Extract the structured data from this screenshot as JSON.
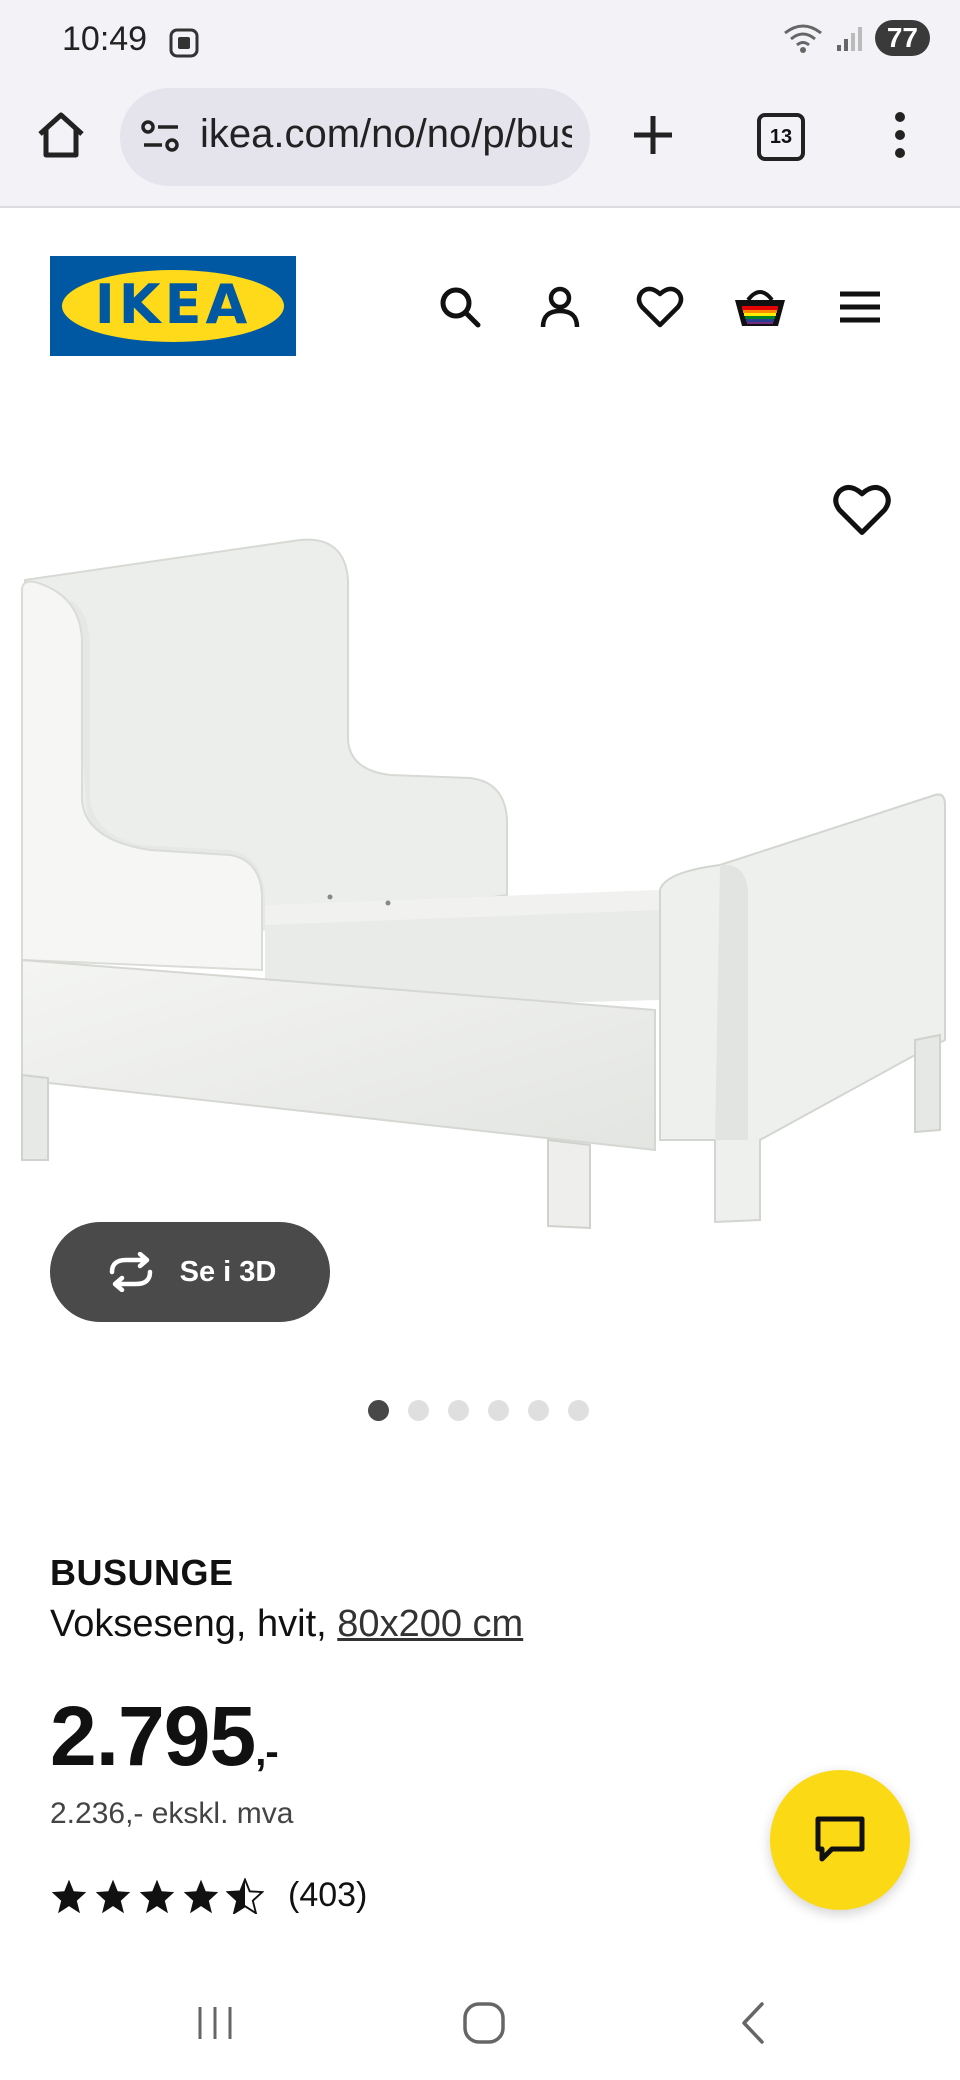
{
  "status_bar": {
    "time": "10:49",
    "battery": "77"
  },
  "browser": {
    "url": "ikea.com/no/no/p/busunge",
    "tab_count": "13"
  },
  "header": {
    "logo_text": "IKEA"
  },
  "gallery": {
    "view_3d_label": "Se i 3D",
    "slide_count": 6,
    "active_slide": 1
  },
  "product": {
    "name": "BUSUNGE",
    "description": "Vokseseng, hvit,",
    "size": "80x200 cm",
    "price": "2.795",
    "price_suffix": ",-",
    "price_ex_vat": "2.236,- ekskl. mva",
    "rating": 4.5,
    "rating_count": "(403)"
  },
  "colors": {
    "ikea_blue": "#0058a3",
    "ikea_yellow": "#ffda1a",
    "chat_yellow": "#fbd914"
  }
}
